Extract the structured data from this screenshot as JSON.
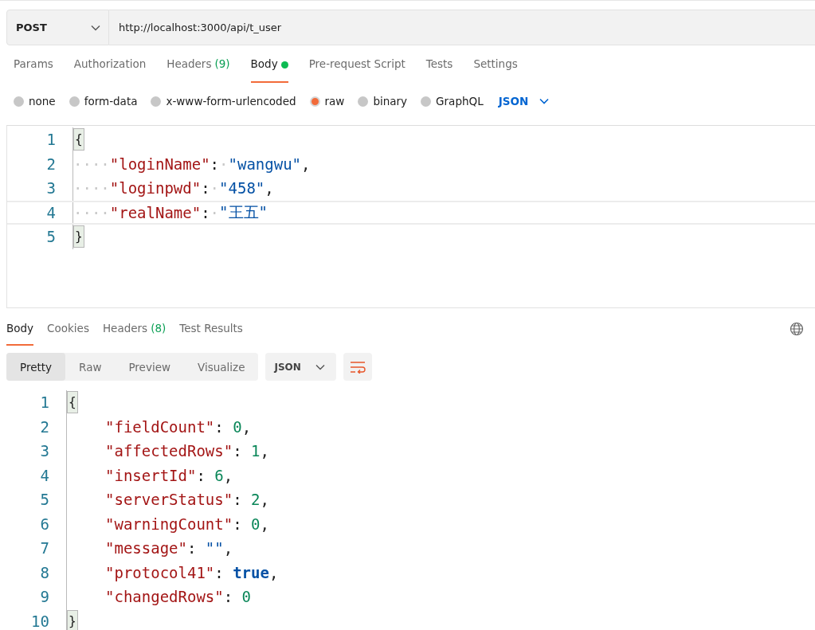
{
  "request": {
    "method": "POST",
    "url": "http://localhost:3000/api/t_user"
  },
  "request_tabs": [
    {
      "label": "Params",
      "selected": false
    },
    {
      "label": "Authorization",
      "selected": false
    },
    {
      "label": "Headers",
      "count": "(9)",
      "selected": false
    },
    {
      "label": "Body",
      "dot": true,
      "selected": true
    },
    {
      "label": "Pre-request Script",
      "selected": false
    },
    {
      "label": "Tests",
      "selected": false
    },
    {
      "label": "Settings",
      "selected": false
    }
  ],
  "body_types": [
    {
      "label": "none",
      "selected": false
    },
    {
      "label": "form-data",
      "selected": false
    },
    {
      "label": "x-www-form-urlencoded",
      "selected": false
    },
    {
      "label": "raw",
      "selected": true
    },
    {
      "label": "binary",
      "selected": false
    },
    {
      "label": "GraphQL",
      "selected": false
    }
  ],
  "body_format": "JSON",
  "request_editor": {
    "lines": [
      {
        "number": "1",
        "active": false,
        "tokens": [
          {
            "kind": "bracket",
            "text": "{"
          }
        ]
      },
      {
        "number": "2",
        "active": false,
        "tokens": [
          {
            "kind": "ws",
            "text": "····"
          },
          {
            "kind": "key",
            "text": "\"loginName\""
          },
          {
            "kind": "punct",
            "text": ":"
          },
          {
            "kind": "ws",
            "text": "·"
          },
          {
            "kind": "string",
            "text": "\"wangwu\""
          },
          {
            "kind": "punct",
            "text": ","
          }
        ]
      },
      {
        "number": "3",
        "active": false,
        "tokens": [
          {
            "kind": "ws",
            "text": "····"
          },
          {
            "kind": "key",
            "text": "\"loginpwd\""
          },
          {
            "kind": "punct",
            "text": ":"
          },
          {
            "kind": "ws",
            "text": "·"
          },
          {
            "kind": "string",
            "text": "\"458\""
          },
          {
            "kind": "punct",
            "text": ","
          }
        ]
      },
      {
        "number": "4",
        "active": true,
        "tokens": [
          {
            "kind": "ws",
            "text": "····"
          },
          {
            "kind": "key",
            "text": "\"realName\""
          },
          {
            "kind": "punct",
            "text": ":"
          },
          {
            "kind": "ws",
            "text": "·"
          },
          {
            "kind": "string",
            "text": "\"王五\""
          }
        ]
      },
      {
        "number": "5",
        "active": false,
        "tokens": [
          {
            "kind": "bracket",
            "text": "}"
          }
        ]
      }
    ]
  },
  "response_tabs": [
    {
      "label": "Body",
      "selected": true
    },
    {
      "label": "Cookies",
      "selected": false
    },
    {
      "label": "Headers",
      "count": "(8)",
      "selected": false
    },
    {
      "label": "Test Results",
      "selected": false
    }
  ],
  "view_modes": [
    {
      "label": "Pretty",
      "selected": true
    },
    {
      "label": "Raw",
      "selected": false
    },
    {
      "label": "Preview",
      "selected": false
    },
    {
      "label": "Visualize",
      "selected": false
    }
  ],
  "response_format": "JSON",
  "response_editor": {
    "lines": [
      {
        "number": "1",
        "indented": false,
        "tokens": [
          {
            "kind": "bracket",
            "text": "{"
          }
        ]
      },
      {
        "number": "2",
        "indented": true,
        "tokens": [
          {
            "kind": "key",
            "text": "\"fieldCount\""
          },
          {
            "kind": "punct",
            "text": ": "
          },
          {
            "kind": "number",
            "text": "0"
          },
          {
            "kind": "punct",
            "text": ","
          }
        ]
      },
      {
        "number": "3",
        "indented": true,
        "tokens": [
          {
            "kind": "key",
            "text": "\"affectedRows\""
          },
          {
            "kind": "punct",
            "text": ": "
          },
          {
            "kind": "number",
            "text": "1"
          },
          {
            "kind": "punct",
            "text": ","
          }
        ]
      },
      {
        "number": "4",
        "indented": true,
        "tokens": [
          {
            "kind": "key",
            "text": "\"insertId\""
          },
          {
            "kind": "punct",
            "text": ": "
          },
          {
            "kind": "number",
            "text": "6"
          },
          {
            "kind": "punct",
            "text": ","
          }
        ]
      },
      {
        "number": "5",
        "indented": true,
        "tokens": [
          {
            "kind": "key",
            "text": "\"serverStatus\""
          },
          {
            "kind": "punct",
            "text": ": "
          },
          {
            "kind": "number",
            "text": "2"
          },
          {
            "kind": "punct",
            "text": ","
          }
        ]
      },
      {
        "number": "6",
        "indented": true,
        "tokens": [
          {
            "kind": "key",
            "text": "\"warningCount\""
          },
          {
            "kind": "punct",
            "text": ": "
          },
          {
            "kind": "number",
            "text": "0"
          },
          {
            "kind": "punct",
            "text": ","
          }
        ]
      },
      {
        "number": "7",
        "indented": true,
        "tokens": [
          {
            "kind": "key",
            "text": "\"message\""
          },
          {
            "kind": "punct",
            "text": ": "
          },
          {
            "kind": "string",
            "text": "\"\""
          },
          {
            "kind": "punct",
            "text": ","
          }
        ]
      },
      {
        "number": "8",
        "indented": true,
        "tokens": [
          {
            "kind": "key",
            "text": "\"protocol41\""
          },
          {
            "kind": "punct",
            "text": ": "
          },
          {
            "kind": "bool",
            "text": "true"
          },
          {
            "kind": "punct",
            "text": ","
          }
        ]
      },
      {
        "number": "9",
        "indented": true,
        "tokens": [
          {
            "kind": "key",
            "text": "\"changedRows\""
          },
          {
            "kind": "punct",
            "text": ": "
          },
          {
            "kind": "number",
            "text": "0"
          }
        ]
      },
      {
        "number": "10",
        "indented": false,
        "tokens": [
          {
            "kind": "bracket",
            "text": "}"
          }
        ]
      }
    ]
  }
}
